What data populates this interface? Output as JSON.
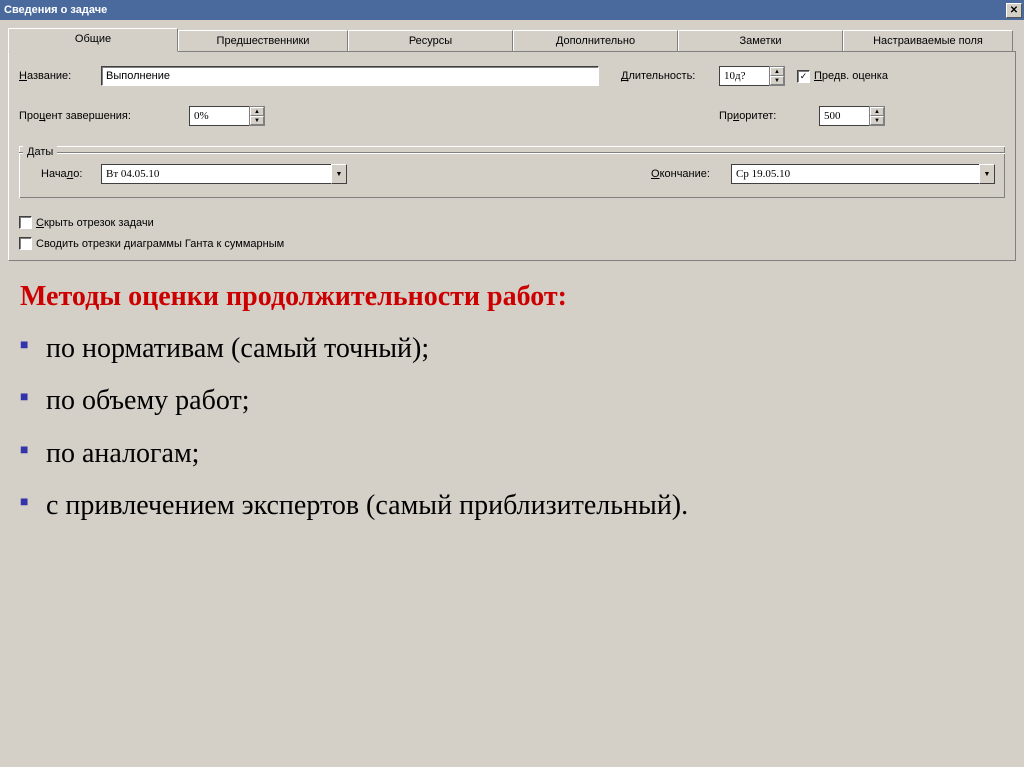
{
  "window": {
    "title": "Сведения о задаче"
  },
  "tabs": [
    "Общие",
    "Предшественники",
    "Ресурсы",
    "Дополнительно",
    "Заметки",
    "Настраиваемые поля"
  ],
  "fields": {
    "name_label_u": "Н",
    "name_label_rest": "азвание:",
    "name_value": "Выполнение",
    "duration_label_u": "Д",
    "duration_label_rest": "лительность:",
    "duration_value": "10д?",
    "estimate_label_u": "П",
    "estimate_label_rest": "редв. оценка",
    "percent_label_pre": "Про",
    "percent_label_u": "ц",
    "percent_label_post": "ент завершения:",
    "percent_value": "0%",
    "priority_label_pre": "Пр",
    "priority_label_u": "и",
    "priority_label_post": "оритет:",
    "priority_value": "500",
    "dates_legend": "Даты",
    "start_label_pre": "Нача",
    "start_label_u": "л",
    "start_label_post": "о:",
    "start_value": "Вт 04.05.10",
    "finish_label_pre": "",
    "finish_label_u": "О",
    "finish_label_post": "кончание:",
    "finish_value": "Ср 19.05.10",
    "hide_bar_label_u": "С",
    "hide_bar_label_rest": "крыть отрезок задачи",
    "rollup_label": "Сводить отрезки диаграммы Ганта к суммарным"
  },
  "slide": {
    "heading": "Методы оценки продолжительности работ:",
    "items": [
      "по нормативам (самый точный);",
      "по объему работ;",
      "по аналогам;",
      "с привлечением экспертов (самый приблизительный)."
    ]
  }
}
